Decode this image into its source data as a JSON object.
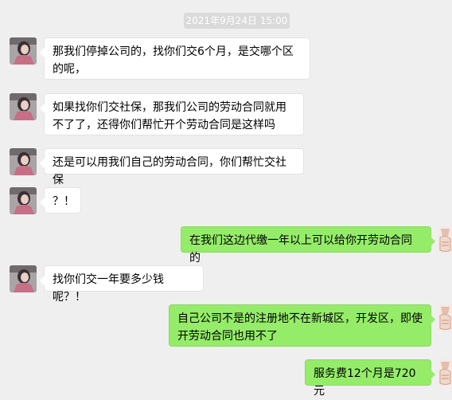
{
  "timestamp": "2021年9月24日 15:00",
  "messages": [
    {
      "side": "left",
      "text": "那我们停掉公司的，找你们交6个月，是交哪个区的呢，"
    },
    {
      "side": "left",
      "text": "如果找你们交社保，那我们公司的劳动合同就用不了了，还得你们帮忙开个劳动合同是这样吗"
    },
    {
      "side": "left",
      "text": "还是可以用我们自己的劳动合同，你们帮忙交社保"
    },
    {
      "side": "left",
      "text": "？！"
    },
    {
      "side": "right",
      "text": "在我们这边代缴一年以上可以给你开劳动合同的"
    },
    {
      "side": "left",
      "text": "找你们交一年要多少钱呢？！"
    },
    {
      "side": "right",
      "text": "自己公司不是的注册地不在新城区，开发区，即使开劳动合同也用不了"
    },
    {
      "side": "right",
      "text": "服务费12个月是720元"
    }
  ],
  "colors": {
    "background": "#efefef",
    "incoming_bubble": "#ffffff",
    "outgoing_bubble": "#95ec69",
    "timestamp_bg": "#dadada"
  }
}
